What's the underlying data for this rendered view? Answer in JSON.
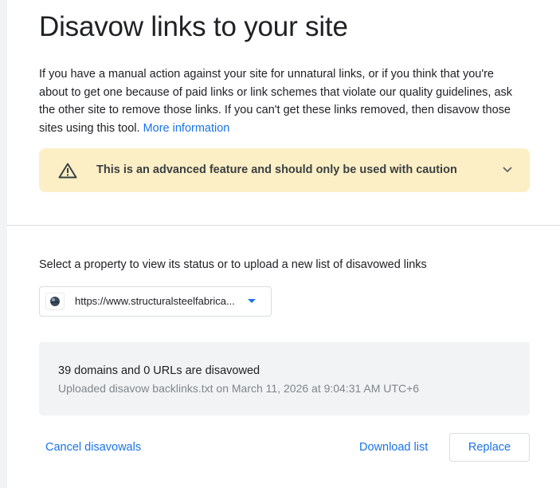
{
  "header": {
    "title": "Disavow links to your site"
  },
  "intro": {
    "text": "If you have a manual action against your site for unnatural links, or if you think that you're about to get one because of paid links or link schemes that violate our quality guidelines, ask the other site to remove those links. If you can't get these links removed, then disavow those sites using this tool.",
    "link_label": "More information"
  },
  "warning": {
    "icon": "warning-triangle-icon",
    "text": "This is an advanced feature and should only be used with caution",
    "expand_icon": "chevron-down-icon",
    "background": "#fcefc6"
  },
  "property": {
    "label": "Select a property to view its status or to upload a new list of disavowed links",
    "selected_value": "https://www.structuralsteelfabrica...",
    "favicon": "site-favicon-icon"
  },
  "status": {
    "summary": "39 domains and 0 URLs are disavowed",
    "detail": "Uploaded disavow backlinks.txt on March 11, 2026 at 9:04:31 AM UTC+6"
  },
  "actions": {
    "cancel_label": "Cancel disavowals",
    "download_label": "Download list",
    "replace_label": "Replace"
  },
  "colors": {
    "accent": "#1a73e8",
    "text": "#202124",
    "muted": "#80868b"
  }
}
